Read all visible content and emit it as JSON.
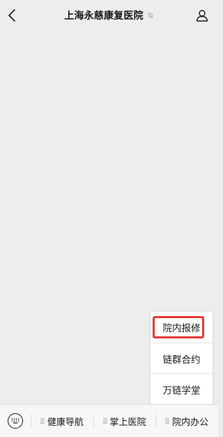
{
  "header": {
    "title": "上海永慈康复医院",
    "back_icon": "chevron-left-icon",
    "muted_icon": "bell-muted-icon",
    "profile_icon": "person-icon"
  },
  "bottom_bar": {
    "keyboard_icon": "keyboard-icon",
    "menus": [
      {
        "label": "健康导航",
        "icon": "menu-lines-icon"
      },
      {
        "label": "掌上医院",
        "icon": "menu-lines-icon"
      },
      {
        "label": "院内办公",
        "icon": "menu-lines-icon"
      }
    ]
  },
  "submenu": {
    "items": [
      {
        "label": "院内报修",
        "highlighted": true
      },
      {
        "label": "链群合约",
        "highlighted": false
      },
      {
        "label": "万链学堂",
        "highlighted": false
      }
    ]
  },
  "colors": {
    "background": "#ededed",
    "highlight_border": "#e53935",
    "text": "#191919"
  }
}
